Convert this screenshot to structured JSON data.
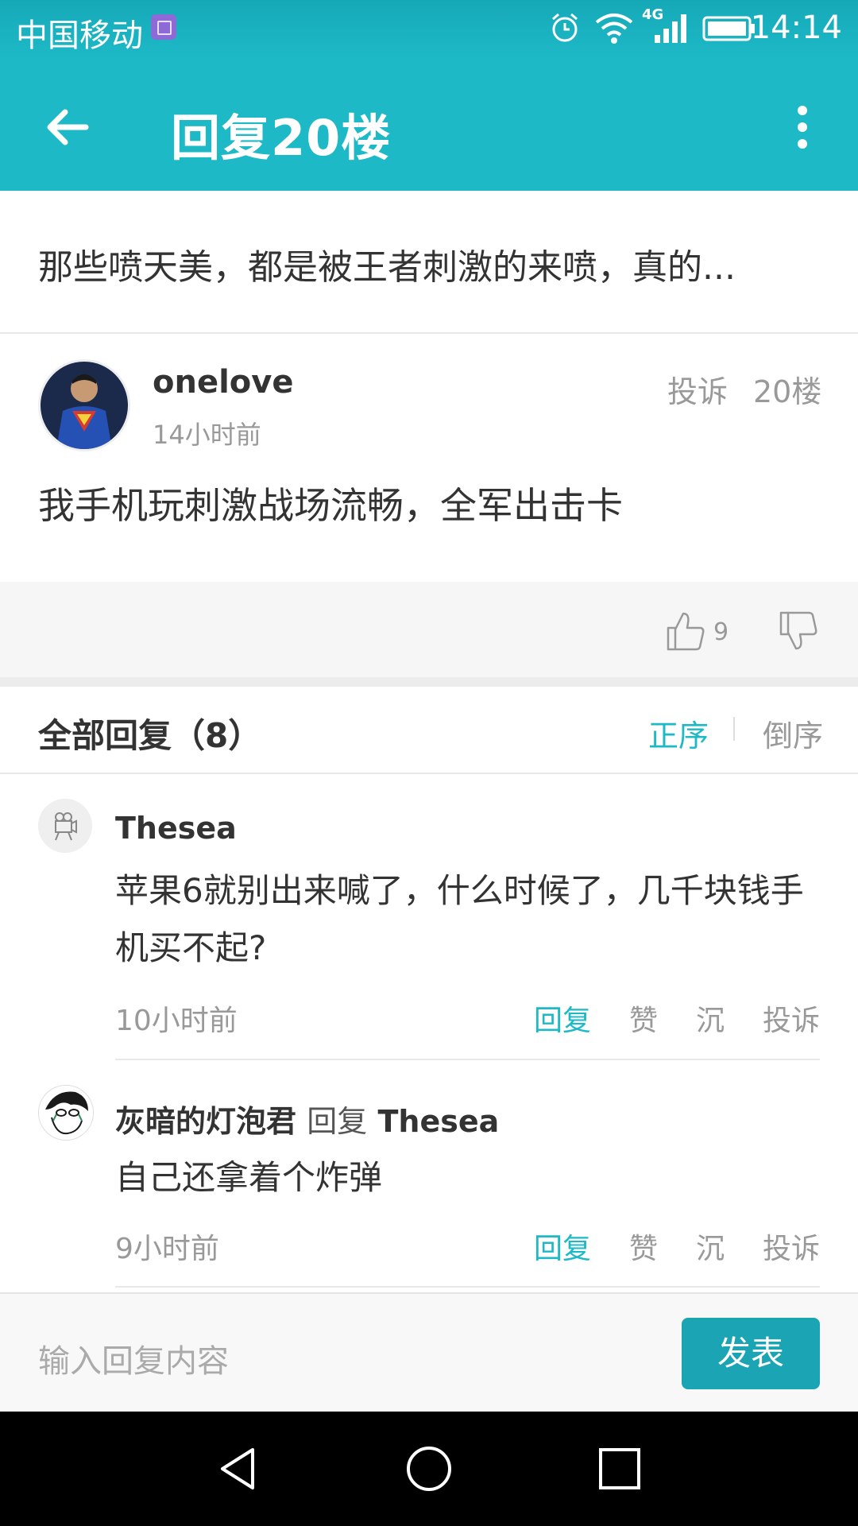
{
  "status_bar": {
    "carrier": "中国移动",
    "network": "4G",
    "time": "14:14"
  },
  "app_bar": {
    "title": "回复20楼"
  },
  "post": {
    "title": "那些喷天美，都是被王者刺激的来喷，真的...",
    "author": "onelove",
    "time": "14小时前",
    "report_label": "投诉",
    "floor": "20楼",
    "body": "我手机玩刺激战场流畅，全军出击卡",
    "like_count": "9"
  },
  "replies_header": {
    "title": "全部回复（8）",
    "sort_asc": "正序",
    "sort_desc": "倒序"
  },
  "replies": [
    {
      "author": "Thesea",
      "reply_prefix": "",
      "reply_target": "",
      "text": "苹果6就别出来喊了，什么时候了，几千块钱手机买不起?",
      "time": "10小时前",
      "actions": [
        "回复",
        "赞",
        "沉",
        "投诉"
      ]
    },
    {
      "author": "灰暗的灯泡君",
      "reply_prefix": "回复",
      "reply_target": "Thesea",
      "text": "自己还拿着个炸弹",
      "time": "9小时前",
      "actions": [
        "回复",
        "赞",
        "沉",
        "投诉"
      ]
    }
  ],
  "input_bar": {
    "placeholder": "输入回复内容",
    "submit_label": "发表"
  },
  "colors": {
    "accent": "#1db9c7",
    "button": "#1ba5b4"
  }
}
